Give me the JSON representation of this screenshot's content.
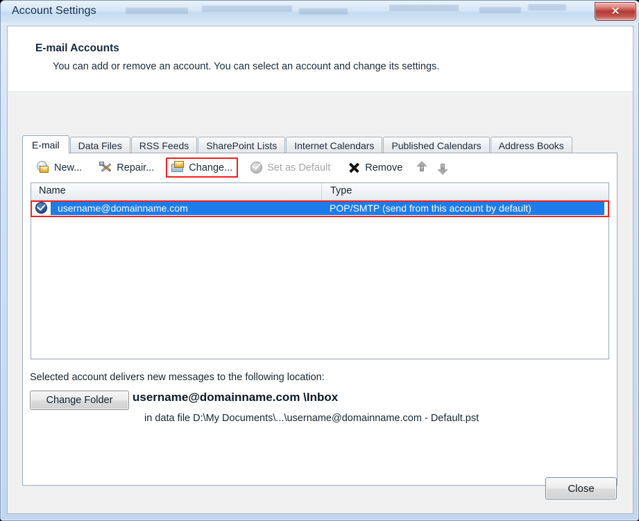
{
  "window": {
    "title": "Account Settings",
    "close_glyph": "✕"
  },
  "header": {
    "title": "E-mail Accounts",
    "subtitle": "You can add or remove an account. You can select an account and change its settings."
  },
  "tabs": [
    {
      "label": "E-mail",
      "active": true
    },
    {
      "label": "Data Files",
      "active": false
    },
    {
      "label": "RSS Feeds",
      "active": false
    },
    {
      "label": "SharePoint Lists",
      "active": false
    },
    {
      "label": "Internet Calendars",
      "active": false
    },
    {
      "label": "Published Calendars",
      "active": false
    },
    {
      "label": "Address Books",
      "active": false
    }
  ],
  "toolbar": {
    "new_label": "New...",
    "repair_label": "Repair...",
    "change_label": "Change...",
    "set_default_label": "Set as Default",
    "remove_label": "Remove",
    "move_up_label": "",
    "move_down_label": "",
    "highlight_color": "#f41f1f"
  },
  "account_list": {
    "columns": [
      "Name",
      "Type"
    ],
    "rows": [
      {
        "name": "username@domainname.com",
        "type": "POP/SMTP (send from this account by default)",
        "is_default": true,
        "selected": true
      }
    ],
    "selection_color": "#1c7ceb"
  },
  "delivery": {
    "label": "Selected account delivers new messages to the following location:",
    "change_folder_label": "Change Folder",
    "location": "username@domainname.com \\Inbox",
    "data_file": "in data file D:\\My Documents\\...\\username@domainname.com  - Default.pst"
  },
  "footer": {
    "close_label": "Close"
  }
}
